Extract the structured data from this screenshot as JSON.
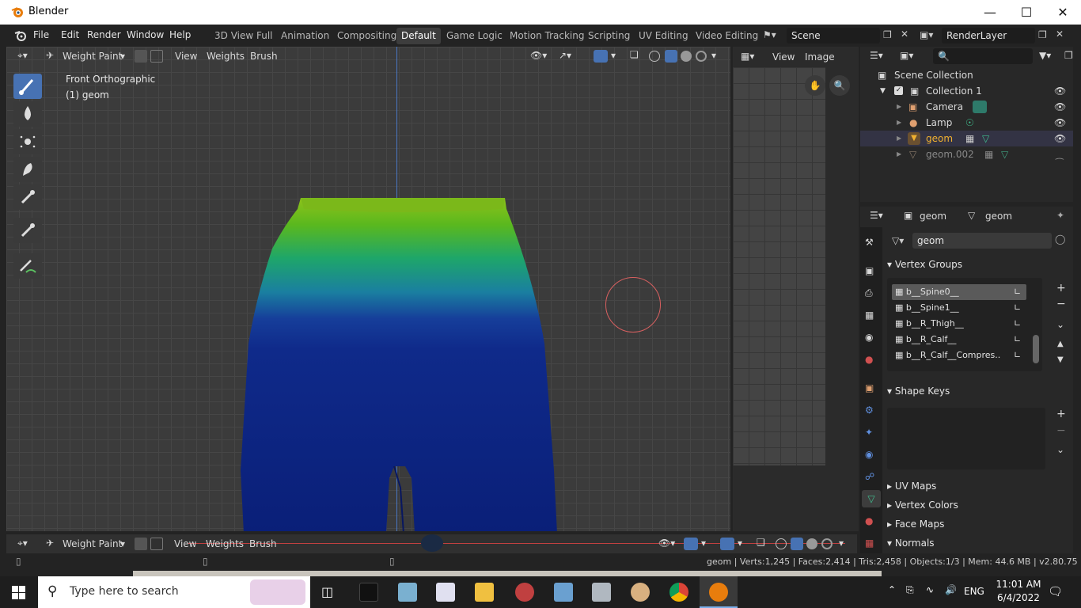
{
  "window": {
    "title": "Blender"
  },
  "menu": [
    "File",
    "Edit",
    "Render",
    "Window",
    "Help"
  ],
  "workspaces": [
    {
      "label": "3D View Full"
    },
    {
      "label": "Animation"
    },
    {
      "label": "Compositing"
    },
    {
      "label": "Default",
      "active": true
    },
    {
      "label": "Game Logic"
    },
    {
      "label": "Motion Tracking"
    },
    {
      "label": "Scripting"
    },
    {
      "label": "UV Editing"
    },
    {
      "label": "Video Editing"
    }
  ],
  "scene": {
    "name": "Scene",
    "render_layer": "RenderLayer"
  },
  "viewport": {
    "mode": "Weight Paint",
    "menus": [
      "View",
      "Weights",
      "Brush"
    ],
    "view_name": "Front Orthographic",
    "object_label": "(1) geom"
  },
  "uv_editor": {
    "menus": [
      "View",
      "Image"
    ]
  },
  "outliner": {
    "root": "Scene Collection",
    "collection": "Collection 1",
    "items": [
      {
        "name": "Camera",
        "color": "#e0a070"
      },
      {
        "name": "Lamp",
        "color": "#e0a070"
      },
      {
        "name": "geom",
        "color": "#f0b030",
        "active": true
      },
      {
        "name": "geom.002",
        "color": "#8a7a6a",
        "dim": true
      }
    ]
  },
  "properties": {
    "context": [
      "geom",
      "geom"
    ],
    "datablock": "geom",
    "vertex_groups_title": "Vertex Groups",
    "vertex_groups": [
      "b__Spine0__",
      "b__Spine1__",
      "b__R_Thigh__",
      "b__R_Calf__",
      "b__R_Calf__Compres.."
    ],
    "shape_keys_title": "Shape Keys",
    "collapsed_panels": [
      "UV Maps",
      "Vertex Colors",
      "Face Maps"
    ],
    "normals_title": "Normals"
  },
  "status": {
    "text": "geom | Verts:1,245 | Faces:2,414 | Tris:2,458 | Objects:1/3 | Mem: 44.6 MB | v2.80.75"
  },
  "taskbar": {
    "search_placeholder": "Type here to search",
    "language": "ENG",
    "time": "11:01 AM",
    "date": "6/4/2022"
  },
  "colors": {
    "accent": "#4772b3",
    "active_object": "#f0b030"
  }
}
